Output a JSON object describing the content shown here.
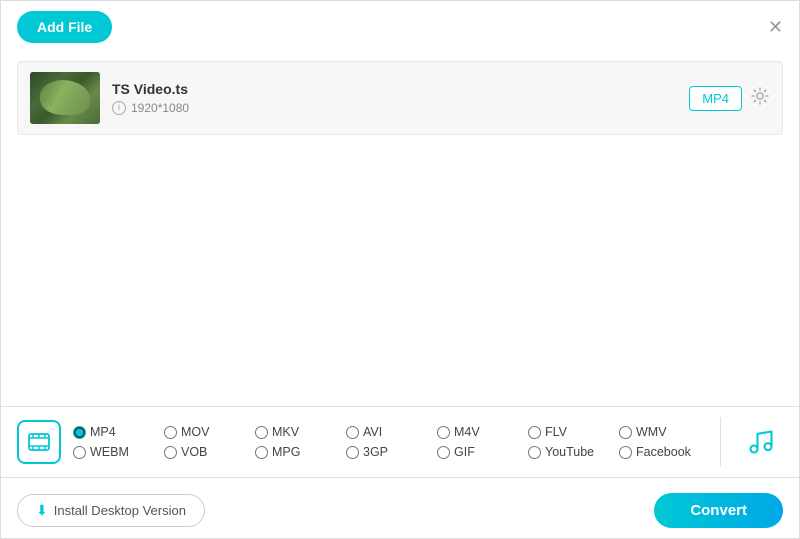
{
  "header": {
    "add_file_label": "Add File",
    "close_label": "✕"
  },
  "file": {
    "name": "TS Video.ts",
    "resolution": "1920*1080",
    "format_badge": "MP4"
  },
  "format_bar": {
    "formats_row1": [
      {
        "id": "mp4",
        "label": "MP4",
        "checked": true
      },
      {
        "id": "mov",
        "label": "MOV",
        "checked": false
      },
      {
        "id": "mkv",
        "label": "MKV",
        "checked": false
      },
      {
        "id": "avi",
        "label": "AVI",
        "checked": false
      },
      {
        "id": "m4v",
        "label": "M4V",
        "checked": false
      },
      {
        "id": "flv",
        "label": "FLV",
        "checked": false
      },
      {
        "id": "wmv",
        "label": "WMV",
        "checked": false
      }
    ],
    "formats_row2": [
      {
        "id": "webm",
        "label": "WEBM",
        "checked": false
      },
      {
        "id": "vob",
        "label": "VOB",
        "checked": false
      },
      {
        "id": "mpg",
        "label": "MPG",
        "checked": false
      },
      {
        "id": "3gp",
        "label": "3GP",
        "checked": false
      },
      {
        "id": "gif",
        "label": "GIF",
        "checked": false
      },
      {
        "id": "youtube",
        "label": "YouTube",
        "checked": false
      },
      {
        "id": "facebook",
        "label": "Facebook",
        "checked": false
      }
    ]
  },
  "footer": {
    "install_label": "Install Desktop Version",
    "convert_label": "Convert"
  }
}
